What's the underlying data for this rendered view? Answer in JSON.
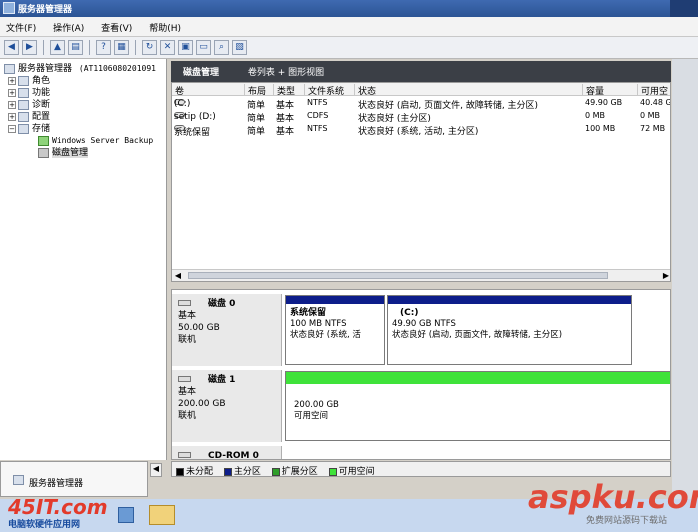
{
  "window": {
    "title": "服务器管理器"
  },
  "menu": [
    "文件(F)",
    "操作(A)",
    "查看(V)",
    "帮助(H)"
  ],
  "toolbar_icons": [
    "back-icon",
    "forward-icon",
    "up-icon",
    "show-tree-icon",
    "help-icon",
    "properties-icon",
    "refresh-icon",
    "delete-icon",
    "settings-icon",
    "open-icon",
    "search-icon",
    "export-icon"
  ],
  "tree": {
    "root": "服务器管理器",
    "root_machine": "(AT1106080201091",
    "roles": "角色",
    "features": "功能",
    "diagnostics": "诊断",
    "configuration": "配置",
    "storage": "存储",
    "backup": "Windows Server Backup",
    "disk_management": "磁盘管理"
  },
  "pane": {
    "title": "磁盘管理",
    "view_label": "卷列表 + 图形视图"
  },
  "volume_table": {
    "headers": [
      "卷",
      "布局",
      "类型",
      "文件系统",
      "状态",
      "容量",
      "可用空"
    ],
    "rows": [
      {
        "volume": "(C:)",
        "layout": "简单",
        "type": "基本",
        "fs": "NTFS",
        "status": "状态良好 (启动, 页面文件, 故障转储, 主分区)",
        "capacity": "49.90 GB",
        "free": "40.48 G"
      },
      {
        "volume": "setip (D:)",
        "layout": "简单",
        "type": "基本",
        "fs": "CDFS",
        "status": "状态良好 (主分区)",
        "capacity": "0 MB",
        "free": "0 MB"
      },
      {
        "volume": "系统保留",
        "layout": "简单",
        "type": "基本",
        "fs": "NTFS",
        "status": "状态良好 (系统, 活动, 主分区)",
        "capacity": "100 MB",
        "free": "72 MB"
      }
    ]
  },
  "disks": [
    {
      "name": "磁盘 0",
      "kind": "基本",
      "size": "50.00 GB",
      "state": "联机",
      "partitions": [
        {
          "title": "系统保留",
          "detail": "100 MB NTFS",
          "status": "状态良好 (系统, 活",
          "color": "#0d1d8a"
        },
        {
          "title": "(C:)",
          "detail": "49.90 GB NTFS",
          "status": "状态良好 (启动, 页面文件, 故障转储, 主分区)",
          "color": "#0d1d8a"
        }
      ]
    },
    {
      "name": "磁盘 1",
      "kind": "基本",
      "size": "200.00 GB",
      "state": "联机",
      "partitions": [
        {
          "title": "",
          "detail": "200.00 GB",
          "status": "可用空间",
          "color": "#3fe23a"
        }
      ]
    },
    {
      "name": "CD-ROM 0"
    }
  ],
  "legend": [
    {
      "label": "未分配",
      "color": "#000000"
    },
    {
      "label": "主分区",
      "color": "#0d1d8a"
    },
    {
      "label": "扩展分区",
      "color": "#2f9e2a"
    },
    {
      "label": "可用空间",
      "color": "#3fe23a"
    }
  ],
  "taskbar": {
    "label": "服务器管理器"
  },
  "watermarks": {
    "left_big": "45IT.com",
    "left_small": "电脑软硬件应用网",
    "right_big": "aspku.com",
    "right_small": "免费网站源码下载站"
  }
}
